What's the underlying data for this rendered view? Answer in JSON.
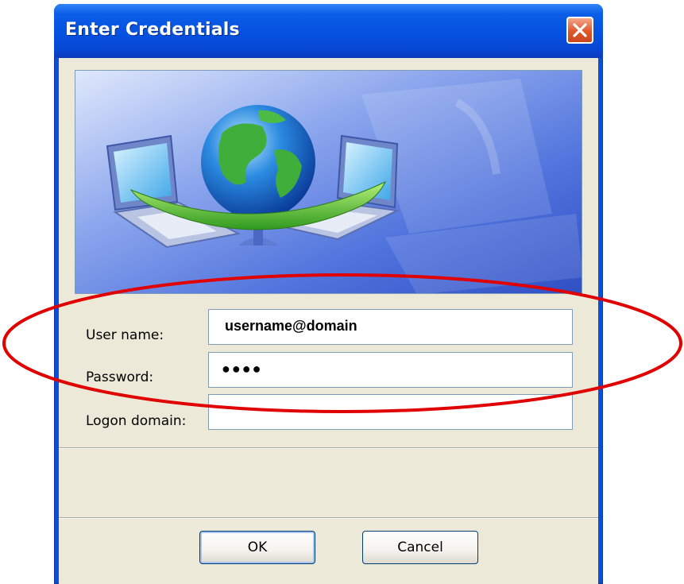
{
  "window": {
    "title": "Enter Credentials"
  },
  "form": {
    "username_label": "User name:",
    "username_value": "username@domain",
    "password_label": "Password:",
    "password_value": "●●●●",
    "domain_label": "Logon domain:",
    "domain_value": ""
  },
  "buttons": {
    "ok_label": "OK",
    "cancel_label": "Cancel"
  },
  "icons": {
    "close": "close-icon",
    "banner": "network-globe-laptops-illustration"
  },
  "colors": {
    "titlebar": "#0551e0",
    "dialog_face": "#ece9d8",
    "close_button": "#e0562a",
    "highlight_ellipse": "#e00000"
  }
}
